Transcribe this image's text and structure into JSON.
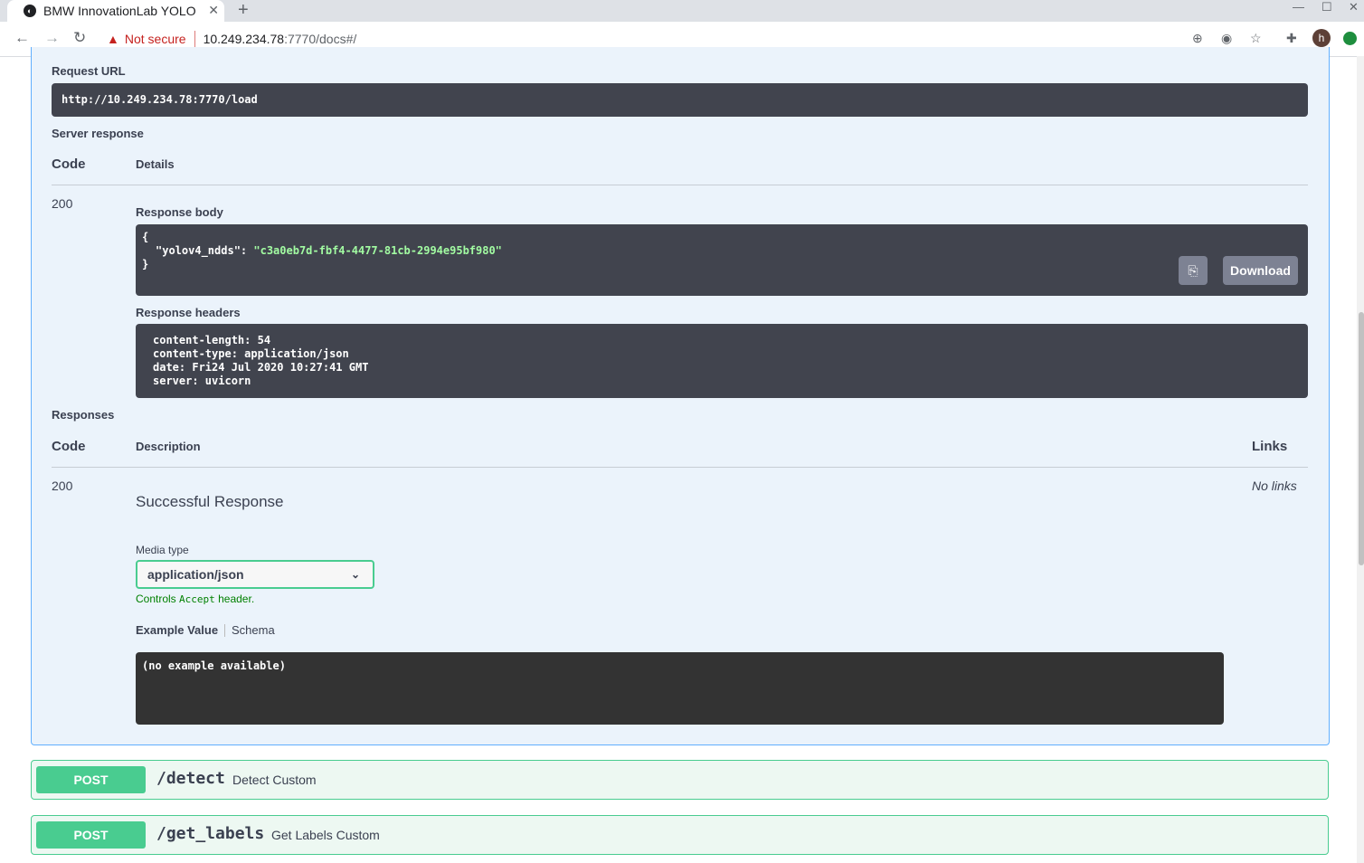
{
  "browser": {
    "tab_title": "BMW InnovationLab YOLO",
    "favicon_glyph": "◐",
    "new_tab": "+",
    "not_secure": "Not secure",
    "url_host": "10.249.234.78",
    "url_rest": ":7770/docs#/",
    "profile_initial": "h"
  },
  "request": {
    "url_label": "Request URL",
    "url_value": "http://10.249.234.78:7770/load"
  },
  "server_response": {
    "label": "Server response",
    "col_code": "Code",
    "col_details": "Details",
    "code": "200",
    "body_label": "Response body",
    "body_lines": [
      "{",
      "  \"yolov4_ndds\": ",
      "}"
    ],
    "body_key": "\"yolov4_ndds\": ",
    "body_value": "\"c3a0eb7d-fbf4-4477-81cb-2994e95bf980\"",
    "download": "Download",
    "headers_label": "Response headers",
    "headers": [
      "content-length: 54",
      "content-type: application/json",
      "date: Fri24 Jul 2020 10:27:41 GMT",
      "server: uvicorn"
    ]
  },
  "responses": {
    "label": "Responses",
    "col_code": "Code",
    "col_description": "Description",
    "col_links": "Links",
    "code": "200",
    "description": "Successful Response",
    "links": "No links",
    "media_type_label": "Media type",
    "media_type_value": "application/json",
    "controls_prefix": "Controls ",
    "controls_code": "Accept",
    "controls_suffix": " header.",
    "tab_example": "Example Value",
    "tab_schema": "Schema",
    "example_text": "(no example available)"
  },
  "endpoints": [
    {
      "method": "POST",
      "path": "/detect",
      "summary": "Detect Custom"
    },
    {
      "method": "POST",
      "path": "/get_labels",
      "summary": "Get Labels Custom"
    }
  ],
  "colors": {
    "post": "#49cc90",
    "get_border": "#61affe",
    "error": "#c5221f"
  }
}
